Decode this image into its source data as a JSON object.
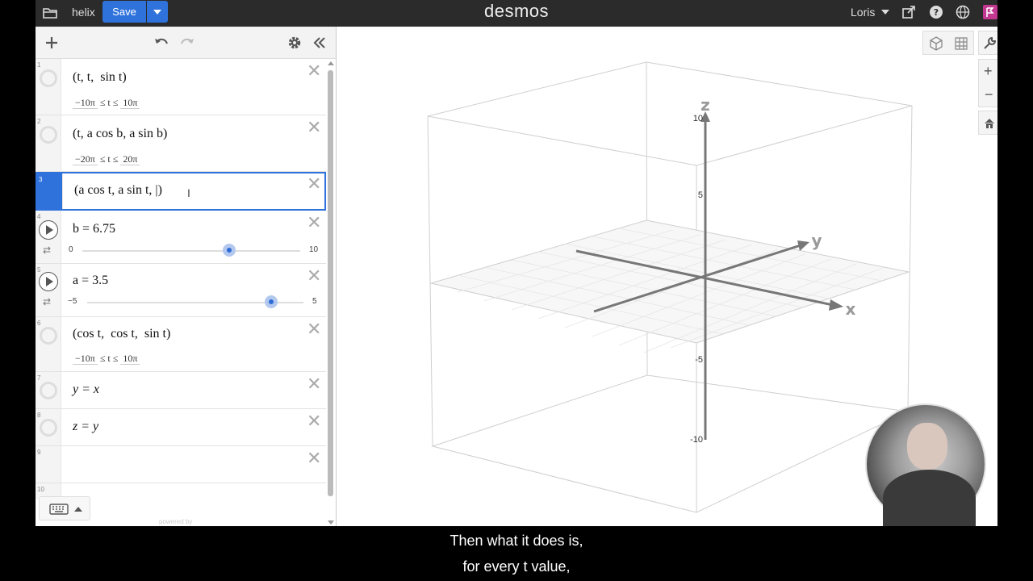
{
  "app": {
    "name": "desmos",
    "graph_title": "helix",
    "save_label": "Save",
    "user": "Loris"
  },
  "expressions": [
    {
      "num": "1",
      "math": "(t, t,  sin t)",
      "domain": {
        "min": "−10π",
        "op": "≤ t ≤",
        "max": "10π"
      }
    },
    {
      "num": "2",
      "math": "(t, a cos b, a sin b)",
      "domain": {
        "min": "−20π",
        "op": "≤ t ≤",
        "max": "20π"
      }
    },
    {
      "num": "3",
      "math": "(a cos t, a sin t, |)"
    },
    {
      "num": "4",
      "math": "b = 6.75",
      "slider": {
        "min": "0",
        "max": "10",
        "value": 6.75,
        "fraction": 0.675
      }
    },
    {
      "num": "5",
      "math": "a = 3.5",
      "slider": {
        "min": "−5",
        "max": "5",
        "value": 3.5,
        "fraction": 0.85
      }
    },
    {
      "num": "6",
      "math": "(cos t,  cos t,  sin t)",
      "domain": {
        "min": "−10π",
        "op": "≤ t ≤",
        "max": "10π"
      }
    },
    {
      "num": "7",
      "math": "y = x"
    },
    {
      "num": "8",
      "math": "z = y"
    },
    {
      "num": "9",
      "math": ""
    },
    {
      "num": "10",
      "math": ""
    }
  ],
  "graph": {
    "axis_x": "x",
    "axis_y": "y",
    "axis_z": "z",
    "z_ticks": [
      "10",
      "5",
      "-5",
      "-10"
    ]
  },
  "footer": {
    "powered": "powered by"
  },
  "captions": [
    "Then what it does is,",
    "for every t value,"
  ],
  "colors": {
    "accent": "#2f72dc",
    "topbar": "#2b2b2b"
  }
}
